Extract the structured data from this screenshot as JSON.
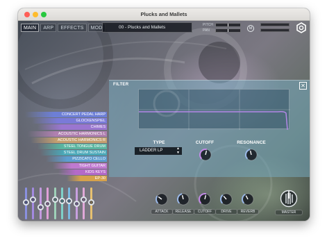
{
  "window": {
    "title": "Plucks and Mallets"
  },
  "tabs": [
    {
      "label": "MAIN",
      "active": true
    },
    {
      "label": "ARP",
      "active": false
    },
    {
      "label": "EFFECTS",
      "active": false
    },
    {
      "label": "MOD",
      "active": false
    }
  ],
  "preset": {
    "name": "00 - Plucks and Mallets"
  },
  "pitch": {
    "label": "PITCH"
  },
  "pan": {
    "label": "PAN"
  },
  "mono_button": {
    "label": "M"
  },
  "settings": {
    "icon": "gear-icon"
  },
  "instruments": [
    {
      "name": "CONCERT PEDAL HARP",
      "color": "#6d7fd6"
    },
    {
      "name": "GLOCKENSPIEL",
      "color": "#7a7ad8"
    },
    {
      "name": "CHIMES",
      "color": "#9a76d0"
    },
    {
      "name": "ACOUSTIC HARMONICS L",
      "color": "#b080b0"
    },
    {
      "name": "ACOUSTIC HARMONICS R",
      "color": "#c6a070"
    },
    {
      "name": "STEEL TONGUE DRUM",
      "color": "#5ab5a0"
    },
    {
      "name": "STEEL DRUM SUSTAIN",
      "color": "#4aa8b8"
    },
    {
      "name": "PIZZICATO CELLO",
      "color": "#5d9ed0"
    },
    {
      "name": "TIGHT GUITAR",
      "color": "#c07ad0"
    },
    {
      "name": "KIDS KEYS",
      "color": "#b46ac8"
    },
    {
      "name": "EP-30",
      "color": "#d6a24c"
    }
  ],
  "volume_sliders": [
    {
      "color": "#8a90e0",
      "level": 0.55
    },
    {
      "color": "#a38ae0",
      "level": 0.62
    },
    {
      "color": "#c49ae0",
      "level": 0.4
    },
    {
      "color": "#e0a0d8",
      "level": 0.5
    },
    {
      "color": "#9ed0b8",
      "level": 0.62
    },
    {
      "color": "#7ed0c8",
      "level": 0.58
    },
    {
      "color": "#7ab8e0",
      "level": 0.58
    },
    {
      "color": "#c8a0e0",
      "level": 0.5
    },
    {
      "color": "#e0a8d8",
      "level": 0.62
    },
    {
      "color": "#e6c070",
      "level": 0.55
    }
  ],
  "filter": {
    "title": "FILTER",
    "close": "✕",
    "type_label": "TYPE",
    "type_value": "LADDER LP",
    "cutoff_label": "CUTOFF",
    "resonance_label": "RESONANCE",
    "cutoff_value": 0.55,
    "resonance_value": 0.45
  },
  "knobs": [
    {
      "label": "ATTACK",
      "value": 0.3,
      "color": "#9ab8e8"
    },
    {
      "label": "RELEASE",
      "value": 0.45,
      "color": "#9ab8e8"
    },
    {
      "label": "CUTOFF",
      "value": 0.55,
      "color": "#c48ae8"
    },
    {
      "label": "DRIVE",
      "value": 0.35,
      "color": "#9ab8e8"
    },
    {
      "label": "REVERB",
      "value": 0.4,
      "color": "#9ab8e8"
    }
  ],
  "master": {
    "label": "MASTER"
  }
}
